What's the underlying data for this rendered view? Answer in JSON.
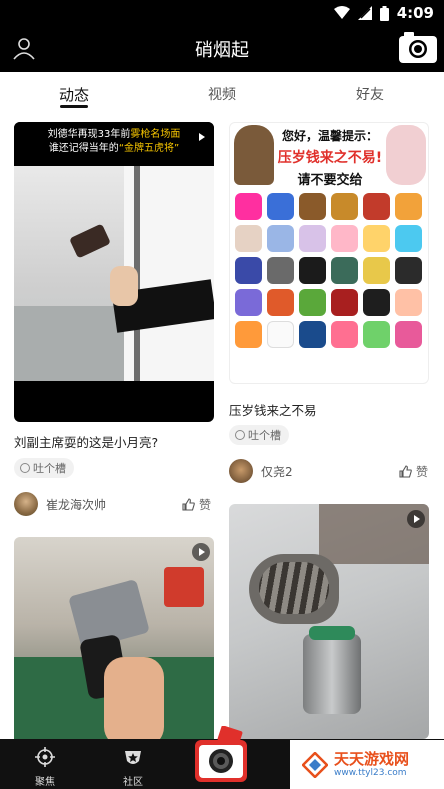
{
  "status": {
    "time": "4:09"
  },
  "header": {
    "title": "硝烟起"
  },
  "tabs": [
    {
      "label": "动态",
      "active": true
    },
    {
      "label": "视频",
      "active": false
    },
    {
      "label": "好友",
      "active": false
    }
  ],
  "feed": {
    "left": [
      {
        "overlay_title_line1": "刘德华再现33年前",
        "overlay_title_hl1": "雾枪名场面",
        "overlay_title_line2": "谁还记得当年的",
        "overlay_title_hl2": "“金牌五虎将”",
        "caption": "刘副主席耍的这是小月亮?",
        "tag": "吐个槽",
        "author": "崔龙海次帅",
        "like_label": "赞"
      },
      {
        "caption": ""
      }
    ],
    "right": [
      {
        "banner_line1": "您好，温馨提示：",
        "banner_line2": "压岁钱来之不易!",
        "banner_line3": "请不要交给",
        "caption": "压岁钱来之不易",
        "tag": "吐个槽",
        "author": "仅尧2",
        "like_label": "赞"
      },
      {
        "caption": ""
      }
    ]
  },
  "bottomnav": {
    "items": [
      {
        "label": "聚焦"
      },
      {
        "label": "社区"
      }
    ]
  },
  "watermark": {
    "line1": "天天游戏网",
    "line2": "www.ttyl23.com"
  },
  "colors": {
    "accent_red": "#e0302b",
    "bar": "#000000"
  }
}
